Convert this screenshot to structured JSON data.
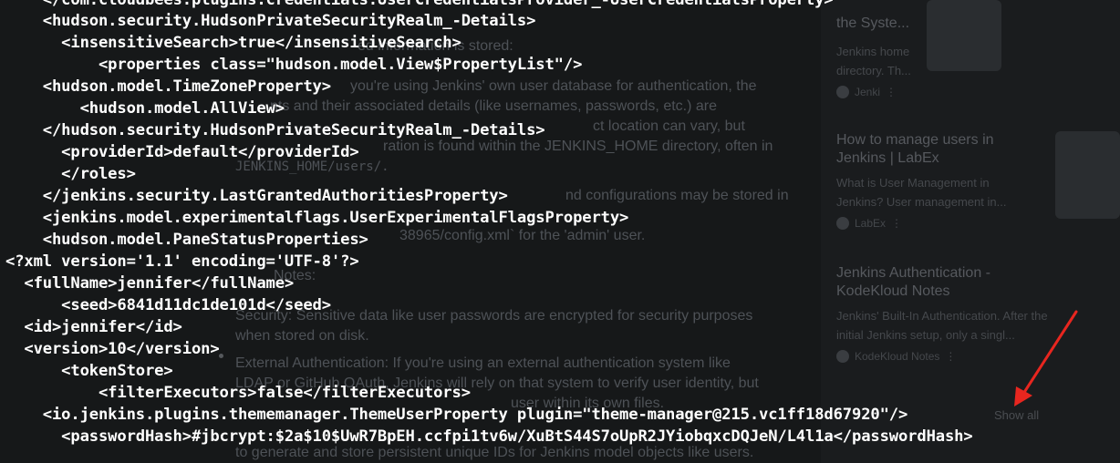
{
  "terminal": {
    "lines": [
      "    </com.cloudbees.plugins.credentials.UserCredentialsProvider_-UserCredentialsProperty>",
      "    <hudson.security.HudsonPrivateSecurityRealm_-Details>",
      "      <insensitiveSearch>true</insensitiveSearch>",
      "          <properties class=\"hudson.model.View$PropertyList\"/>",
      "    <hudson.model.TimeZoneProperty>",
      "        <hudson.model.AllView>",
      "    </hudson.security.HudsonPrivateSecurityRealm_-Details>",
      "      <providerId>default</providerId>",
      "      </roles>",
      "    </jenkins.security.LastGrantedAuthoritiesProperty>",
      "    <jenkins.model.experimentalflags.UserExperimentalFlagsProperty>",
      "    <hudson.model.PaneStatusProperties>",
      "<?xml version='1.1' encoding='UTF-8'?>",
      "  <fullName>jennifer</fullName>",
      "      <seed>6841d11dc1de101d</seed>",
      "  <id>jennifer</id>",
      "  <version>10</version>",
      "      <tokenStore>",
      "          <filterExecutors>false</filterExecutors>",
      "    <io.jenkins.plugins.thememanager.ThemeUserProperty plugin=\"theme-manager@215.vc1ff18d67920\"/>",
      "      <passwordHash>#jbcrypt:$2a$10$UwR7BpEH.ccfpi1tv6w/XuBtS44S7oUpR2JYiobqxcDQJeN/L4l1a</passwordHash>"
    ]
  },
  "background_page": {
    "paragraphs": [
      "ed information is stored:",
      "you're using Jenkins' own user database for authentication, the",
      "nts and their associated details (like usernames, passwords, etc.) are",
      "ct location can vary, but",
      "ration is found within the JENKINS_HOME directory, often in",
      "JENKINS_HOME/users/.",
      "nd configurations may be stored in",
      "38965/config.xml` for the 'admin' user.",
      "Notes:",
      "Security: Sensitive data like user passwords are encrypted for security purposes",
      "when stored on disk.",
      "External Authentication: If you're using an external authentication system like",
      "LDAP or GitHub OAuth, Jenkins will rely on that system to verify user identity, but",
      "user within its own files.",
      "to generate and store persistent unique IDs for Jenkins model objects like users."
    ],
    "results": [
      {
        "title": "the Syste...",
        "snippet": "Jenkins home directory. Th...",
        "source": "Jenki"
      },
      {
        "title": "How to manage users in Jenkins | LabEx",
        "snippet": "What is User Management in Jenkins? User management in...",
        "source": "LabEx"
      },
      {
        "title": "Jenkins Authentication - KodeKloud Notes",
        "snippet": "Jenkins' Built-In Authentication. After the initial Jenkins setup, only a singl...",
        "source": "KodeKloud Notes"
      }
    ],
    "show_all": "Show all"
  },
  "colors": {
    "terminal_bg": "#161819",
    "terminal_text": "#ffffff",
    "arrow": "#e8261f"
  }
}
